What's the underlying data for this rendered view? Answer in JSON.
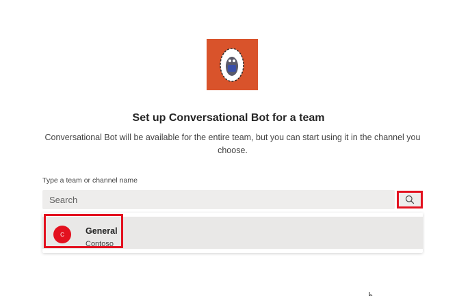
{
  "title": "Set up Conversational Bot for a team",
  "description": "Conversational Bot will be available for the entire team, but you can start using it in the channel you choose.",
  "search": {
    "label": "Type a team or channel name",
    "placeholder": "Search",
    "value": ""
  },
  "results": [
    {
      "initial": "C",
      "name": "General",
      "team": "Contoso"
    }
  ],
  "colors": {
    "app_icon_bg": "#d9532b",
    "highlight": "#e3111f",
    "input_bg": "#eeedec"
  },
  "icons": {
    "app": "conversational-bot-mascot",
    "search": "magnifier"
  }
}
